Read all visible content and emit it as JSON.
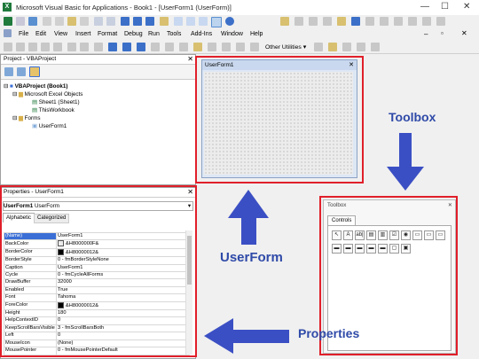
{
  "window": {
    "title": "Microsoft Visual Basic for Applications - Book1 - [UserForm1 (UserForm)]",
    "app_icon": "excel-x-icon"
  },
  "menu": {
    "items": [
      "File",
      "Edit",
      "View",
      "Insert",
      "Format",
      "Debug",
      "Run",
      "Tools",
      "Add-Ins",
      "Window",
      "Help"
    ],
    "other_utilities": "Other Utilities"
  },
  "project": {
    "title": "Project - VBAProject",
    "root": "VBAProject (Book1)",
    "folder_objects": "Microsoft Excel Objects",
    "sheet": "Sheet1 (Sheet1)",
    "workbook": "ThisWorkbook",
    "folder_forms": "Forms",
    "form": "UserForm1"
  },
  "form": {
    "caption": "UserForm1"
  },
  "properties": {
    "title": "Properties - UserForm1",
    "object_name": "UserForm1",
    "object_type": "UserForm",
    "tab_alpha": "Alphabetic",
    "tab_cat": "Categorized",
    "rows": [
      {
        "k": "(Name)",
        "v": "UserForm1"
      },
      {
        "k": "BackColor",
        "v": "&H8000000F&",
        "swatch": "#ececec"
      },
      {
        "k": "BorderColor",
        "v": "&H80000012&",
        "swatch": "#000000"
      },
      {
        "k": "BorderStyle",
        "v": "0 - fmBorderStyleNone"
      },
      {
        "k": "Caption",
        "v": "UserForm1"
      },
      {
        "k": "Cycle",
        "v": "0 - fmCycleAllForms"
      },
      {
        "k": "DrawBuffer",
        "v": "32000"
      },
      {
        "k": "Enabled",
        "v": "True"
      },
      {
        "k": "Font",
        "v": "Tahoma"
      },
      {
        "k": "ForeColor",
        "v": "&H80000012&",
        "swatch": "#000000"
      },
      {
        "k": "Height",
        "v": "180"
      },
      {
        "k": "HelpContextID",
        "v": "0"
      },
      {
        "k": "KeepScrollBarsVisible",
        "v": "3 - fmScrollBarsBoth"
      },
      {
        "k": "Left",
        "v": "0"
      },
      {
        "k": "MouseIcon",
        "v": "(None)"
      },
      {
        "k": "MousePointer",
        "v": "0 - fmMousePointerDefault"
      }
    ]
  },
  "toolbox": {
    "title": "Toolbox",
    "tab": "Controls",
    "row1": [
      "↖",
      "A",
      "ab|",
      "▤",
      "▥",
      "☑",
      "◉",
      "▭",
      "▭",
      "▭"
    ],
    "row2": [
      "▬",
      "▬",
      "▬",
      "▬",
      "▬",
      "▢",
      "▣"
    ]
  },
  "annotations": {
    "userform": "UserForm",
    "toolbox": "Toolbox",
    "properties": "Properties",
    "arrow_color": "#3b4fc4",
    "highlight_color": "#e01f2a"
  }
}
